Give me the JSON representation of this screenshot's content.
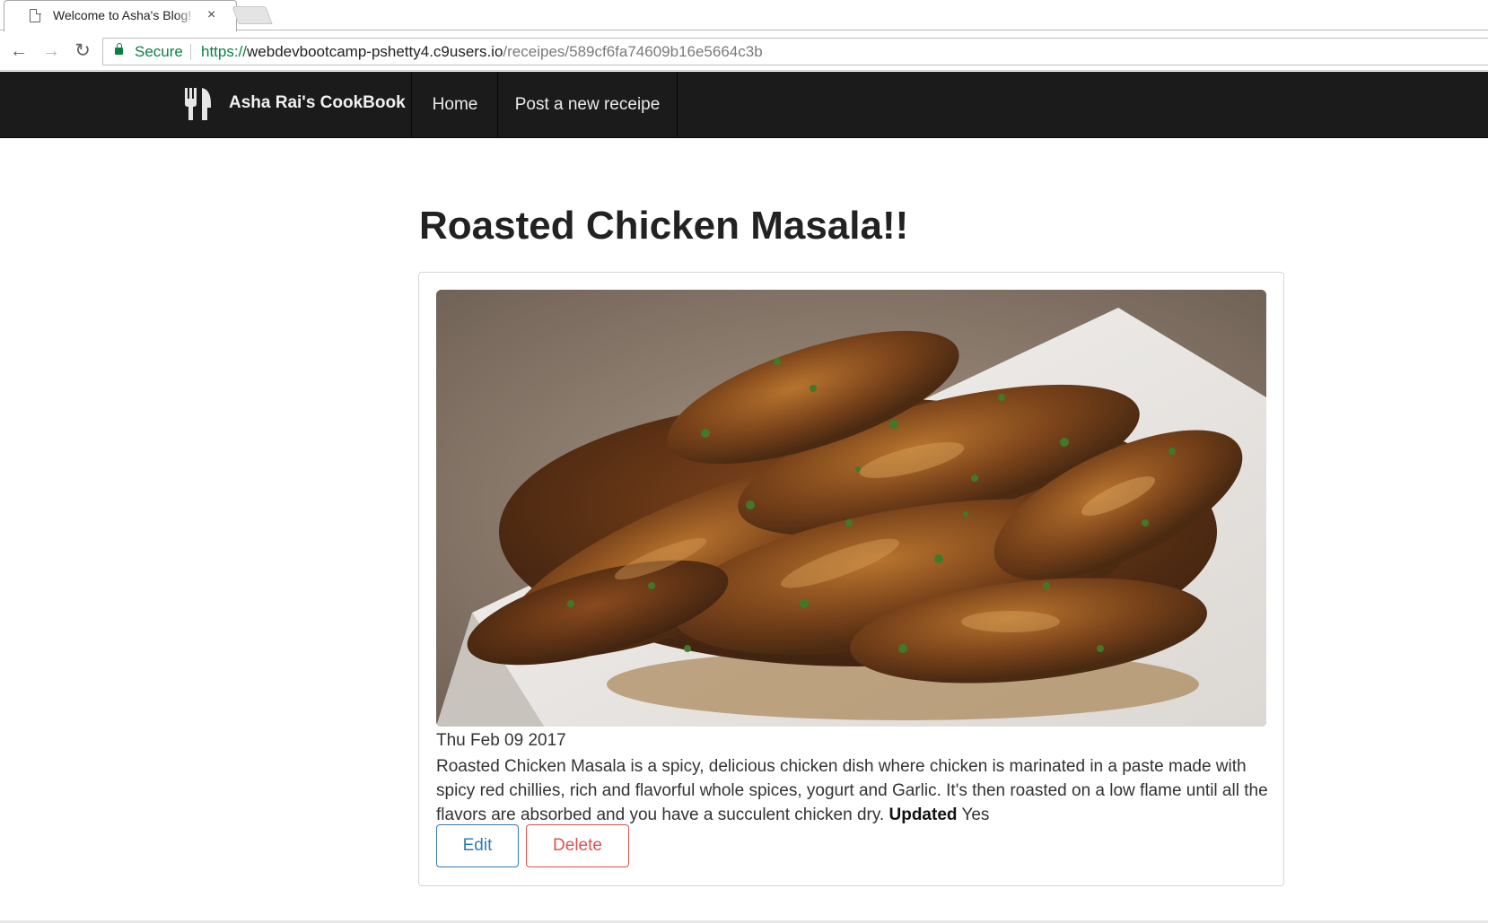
{
  "browser": {
    "tab_title": "Welcome to Asha's Blog!",
    "tab_close": "×",
    "secure_label": "Secure",
    "url_scheme": "https://",
    "url_host": "webdevbootcamp-pshetty4.c9users.io",
    "url_path": "/receipes/589cf6fa74609b16e5664c3b",
    "icons": {
      "back": "←",
      "forward": "→",
      "reload": "↻"
    }
  },
  "navbar": {
    "brand": "Asha Rai's CookBook",
    "brand_icon": "cutlery-icon",
    "links": [
      "Home",
      "Post a new receipe"
    ]
  },
  "recipe": {
    "title": "Roasted Chicken Masala!!",
    "date": "Thu Feb 09 2017",
    "description": "Roasted Chicken Masala is a spicy, delicious chicken dish where chicken is marinated in a paste made with spicy red chillies, rich and flavorful whole spices, yogurt and Garlic. It's then roasted on a low flame until all the flavors are absorbed and you have a succulent chicken dry.",
    "updated_label": "Updated",
    "updated_value": "Yes",
    "edit_label": "Edit",
    "delete_label": "Delete"
  },
  "colors": {
    "navbar_bg": "#1b1b1b",
    "secure_green": "#0b8043",
    "edit_blue": "#337ab7",
    "delete_red": "#d9534f"
  }
}
